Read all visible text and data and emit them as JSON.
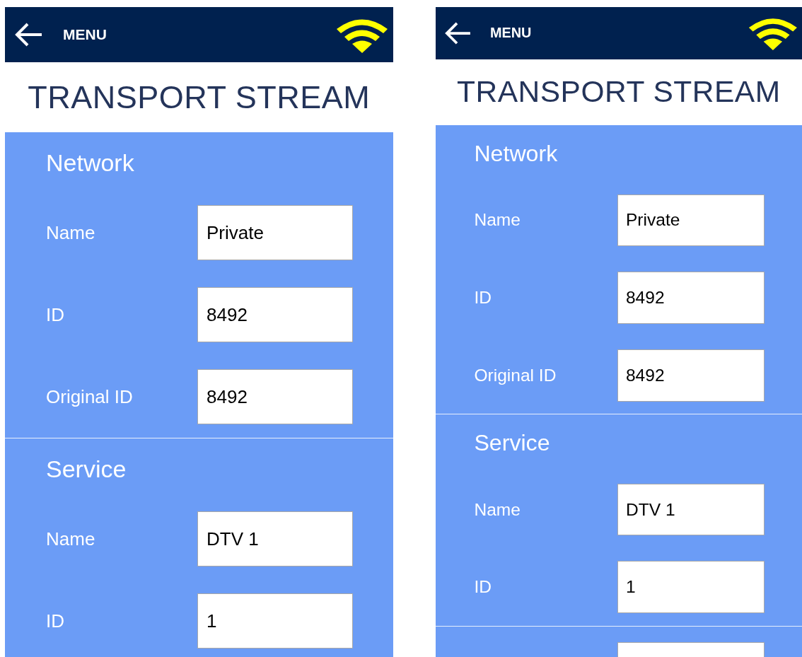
{
  "screens": [
    {
      "header": {
        "menu": "MENU"
      },
      "title": "TRANSPORT STREAM",
      "sections": [
        {
          "heading": "Network",
          "rows": [
            {
              "label": "Name",
              "value": "Private"
            },
            {
              "label": "ID",
              "value": "8492"
            },
            {
              "label": "Original ID",
              "value": "8492"
            }
          ]
        },
        {
          "heading": "Service",
          "rows": [
            {
              "label": "Name",
              "value": "DTV 1"
            },
            {
              "label": "ID",
              "value": "1"
            }
          ]
        }
      ]
    },
    {
      "header": {
        "menu": "MENU"
      },
      "title": "TRANSPORT STREAM",
      "sections": [
        {
          "heading": "Network",
          "rows": [
            {
              "label": "Name",
              "value": "Private"
            },
            {
              "label": "ID",
              "value": "8492"
            },
            {
              "label": "Original ID",
              "value": "8492"
            }
          ]
        },
        {
          "heading": "Service",
          "rows": [
            {
              "label": "Name",
              "value": "DTV 1"
            },
            {
              "label": "ID",
              "value": "1"
            }
          ]
        },
        {
          "rows": [
            {}
          ]
        }
      ]
    }
  ]
}
